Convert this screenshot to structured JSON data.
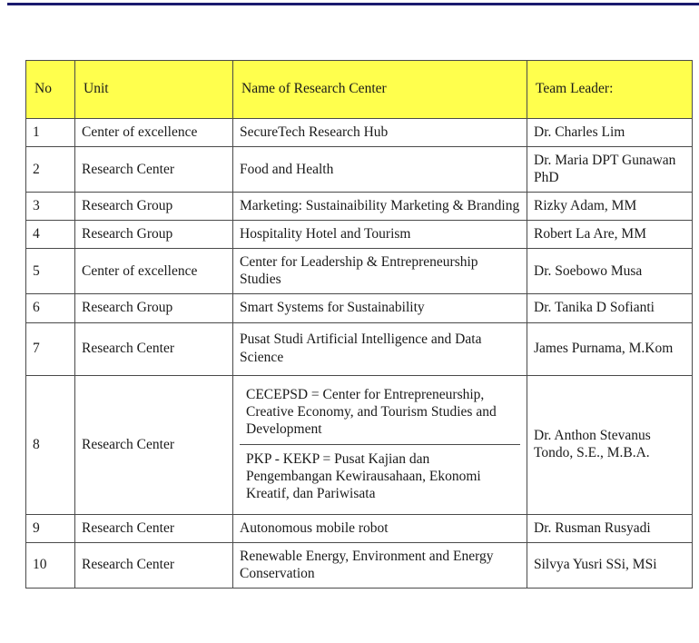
{
  "document": {
    "accent_rule_color": "#1a1a6e",
    "header_fill_color": "#ffff4d",
    "grid_color": "#4a4a4a"
  },
  "table": {
    "columns": [
      {
        "key": "no",
        "label": "No"
      },
      {
        "key": "unit",
        "label": "Unit"
      },
      {
        "key": "name",
        "label": "Name of Research Center"
      },
      {
        "key": "leader",
        "label": "Team Leader:"
      }
    ],
    "rows": [
      {
        "no": "1",
        "unit": "Center of excellence",
        "name": "SecureTech Research Hub",
        "leader": "Dr. Charles Lim"
      },
      {
        "no": "2",
        "unit": "Research Center",
        "name": "Food and Health",
        "leader": "Dr. Maria DPT Gunawan PhD"
      },
      {
        "no": "3",
        "unit": "Research Group",
        "name": "Marketing: Sustainaibility Marketing & Branding",
        "leader": "Rizky Adam, MM"
      },
      {
        "no": "4",
        "unit": "Research Group",
        "name": "Hospitality Hotel and Tourism",
        "leader": "Robert La Are, MM"
      },
      {
        "no": "5",
        "unit": "Center of excellence",
        "name": "Center for Leadership & Entrepreneurship Studies",
        "leader": "Dr. Soebowo Musa"
      },
      {
        "no": "6",
        "unit": "Research Group",
        "name": "Smart Systems for Sustainability",
        "leader": "Dr. Tanika D Sofianti"
      },
      {
        "no": "7",
        "unit": "Research Center",
        "name": "Pusat Studi Artificial Intelligence and Data Science",
        "leader": "James Purnama, M.Kom"
      },
      {
        "no": "8",
        "unit": "Research Center",
        "name_parts": [
          "CECEPSD = Center for Entrepreneurship, Creative Economy, and Tourism Studies and Development",
          "PKP - KEKP = Pusat Kajian dan Pengembangan Kewirausahaan, Ekonomi Kreatif, dan Pariwisata"
        ],
        "leader": "Dr. Anthon Stevanus Tondo, S.E., M.B.A."
      },
      {
        "no": "9",
        "unit": "Research Center",
        "name": "Autonomous mobile robot",
        "leader": "Dr. Rusman Rusyadi"
      },
      {
        "no": "10",
        "unit": "Research Center",
        "name": "Renewable Energy, Environment and Energy Conservation",
        "leader": "Silvya Yusri SSi, MSi"
      }
    ]
  }
}
